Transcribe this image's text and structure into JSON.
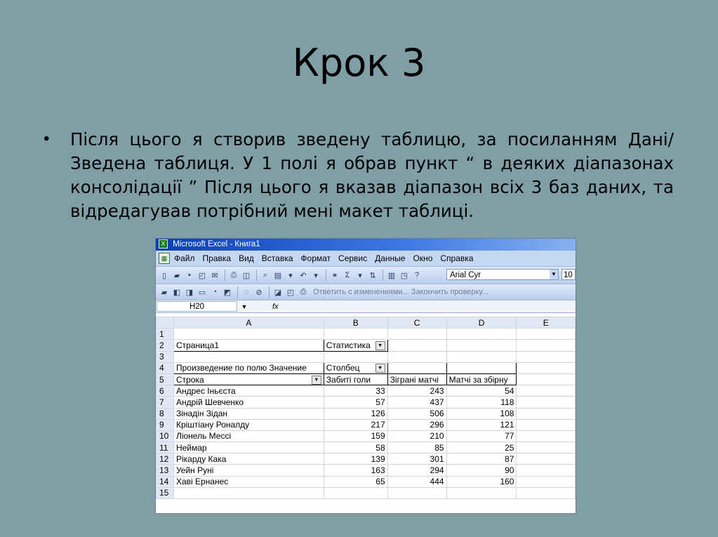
{
  "slide": {
    "title": "Крок 3",
    "bullet": "Після цього я створив зведену таблицю, за посиланням Дані/Зведена таблиця. У 1 полі я обрав пункт “ в деяких діапазонах консолідації ”  Після цього я вказав діапазон всіх 3 баз даних, та відредагував потрібний мені макет таблиці."
  },
  "excel": {
    "window_title": "Microsoft Excel - Книга1",
    "menu": [
      "Файл",
      "Правка",
      "Вид",
      "Вставка",
      "Формат",
      "Сервис",
      "Данные",
      "Окно",
      "Справка"
    ],
    "font_name": "Arial Cyr",
    "font_size": "10",
    "reply_text": "Ответить с изменениями...  Закончить проверку...",
    "name_box": "H20",
    "fx_label": "fx",
    "columns": [
      "A",
      "B",
      "C",
      "D",
      "E"
    ],
    "rows": [
      {
        "n": "1",
        "a": "",
        "b": "",
        "c": "",
        "d": "",
        "e": ""
      },
      {
        "n": "2",
        "a": "Страница1",
        "b": "Статистика",
        "c": "",
        "d": "",
        "e": ""
      },
      {
        "n": "3",
        "a": "",
        "b": "",
        "c": "",
        "d": "",
        "e": ""
      },
      {
        "n": "4",
        "a": "Произведение по полю Значение",
        "b": "Столбец",
        "c": "",
        "d": "",
        "e": ""
      },
      {
        "n": "5",
        "a": "Строка",
        "b": "Забиті голи",
        "c": "Зіграні матчі",
        "d": "Матчі за збірну",
        "e": ""
      },
      {
        "n": "6",
        "a": "Андрес Іньєста",
        "b": "33",
        "c": "243",
        "d": "54",
        "e": ""
      },
      {
        "n": "7",
        "a": "Андрій Шевченко",
        "b": "57",
        "c": "437",
        "d": "118",
        "e": ""
      },
      {
        "n": "8",
        "a": "Зінадін Зідан",
        "b": "126",
        "c": "506",
        "d": "108",
        "e": ""
      },
      {
        "n": "9",
        "a": "Кріштіану Роналду",
        "b": "217",
        "c": "296",
        "d": "121",
        "e": ""
      },
      {
        "n": "10",
        "a": "Ліонель Мессі",
        "b": "159",
        "c": "210",
        "d": "77",
        "e": ""
      },
      {
        "n": "11",
        "a": "Неймар",
        "b": "58",
        "c": "85",
        "d": "25",
        "e": ""
      },
      {
        "n": "12",
        "a": "Рікарду Кака",
        "b": "139",
        "c": "301",
        "d": "87",
        "e": ""
      },
      {
        "n": "13",
        "a": "Уейн Руні",
        "b": "163",
        "c": "294",
        "d": "90",
        "e": ""
      },
      {
        "n": "14",
        "a": "Хаві Ернанес",
        "b": "65",
        "c": "444",
        "d": "160",
        "e": ""
      },
      {
        "n": "15",
        "a": "",
        "b": "",
        "c": "",
        "d": "",
        "e": ""
      }
    ]
  }
}
